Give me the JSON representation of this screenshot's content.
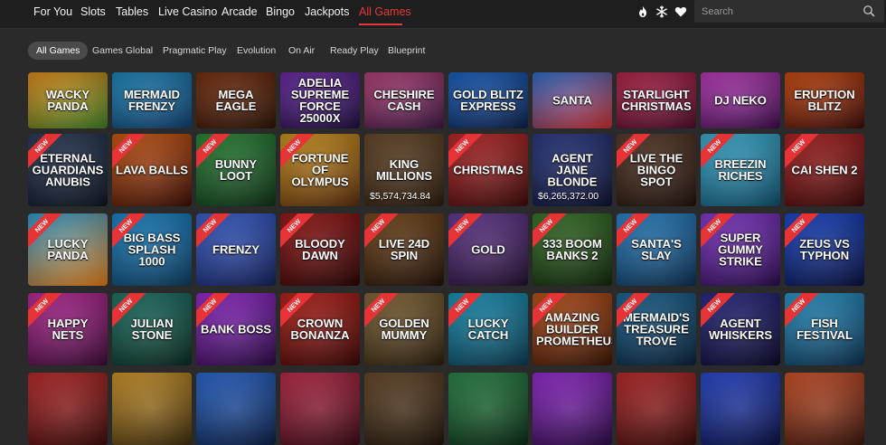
{
  "nav": {
    "items": [
      "For You",
      "Slots",
      "Tables",
      "Live Casino",
      "Arcade",
      "Bingo",
      "Jackpots",
      "All Games"
    ],
    "active_index": 7,
    "icons": [
      "flame-icon",
      "snowflake-icon",
      "heart-icon"
    ],
    "search_placeholder": "Search"
  },
  "providers": {
    "items": [
      "All Games",
      "Games Global",
      "Pragmatic Play",
      "Evolution",
      "On Air",
      "Ready Play",
      "Blueprint"
    ],
    "active_index": 0
  },
  "colors": {
    "accent": "#e8383a",
    "badge": "#e63336"
  },
  "rows": [
    [
      {
        "title": "Wacky Panda",
        "bg": [
          "#e98e1b",
          "#3c7d22"
        ],
        "badge": "",
        "jackpot": ""
      },
      {
        "title": "Mermaid Frenzy",
        "bg": [
          "#1d8ac0",
          "#0f3c6a"
        ],
        "badge": "",
        "jackpot": ""
      },
      {
        "title": "Mega Eagle",
        "bg": [
          "#7a2f0e",
          "#2b1205"
        ],
        "badge": "",
        "jackpot": ""
      },
      {
        "title": "Adelia Supreme Force 25000x",
        "bg": [
          "#6b2aa8",
          "#1f0d3e"
        ],
        "badge": "",
        "jackpot": ""
      },
      {
        "title": "Cheshire Cash",
        "bg": [
          "#b8417a",
          "#3b1640"
        ],
        "badge": "",
        "jackpot": ""
      },
      {
        "title": "Gold Blitz Express",
        "bg": [
          "#1a63c7",
          "#0a1f48"
        ],
        "badge": "",
        "jackpot": ""
      },
      {
        "title": "Santa",
        "bg": [
          "#2d6fd1",
          "#c82c2c"
        ],
        "badge": "",
        "jackpot": ""
      },
      {
        "title": "Starlight Christmas",
        "bg": [
          "#b8254a",
          "#4c0a2a"
        ],
        "badge": "",
        "jackpot": ""
      },
      {
        "title": "DJ Neko",
        "bg": [
          "#c03bbf",
          "#3c0c4a"
        ],
        "badge": "",
        "jackpot": ""
      },
      {
        "title": "Eruption Blitz",
        "bg": [
          "#d14a10",
          "#3a0a05"
        ],
        "badge": "",
        "jackpot": ""
      }
    ],
    [
      {
        "title": "Eternal Guardians Anubis",
        "bg": [
          "#2a3c5a",
          "#0d1422"
        ],
        "badge": "NEW",
        "jackpot": ""
      },
      {
        "title": "Lava Balls",
        "bg": [
          "#d65b14",
          "#3b0d04"
        ],
        "badge": "NEW",
        "jackpot": ""
      },
      {
        "title": "Bunny Loot",
        "bg": [
          "#2c8b3a",
          "#0d3016"
        ],
        "badge": "NEW",
        "jackpot": ""
      },
      {
        "title": "Fortune of Olympus",
        "bg": [
          "#d59a1f",
          "#5a2b0a"
        ],
        "badge": "NEW",
        "jackpot": ""
      },
      {
        "title": "King Millions",
        "bg": [
          "#6a4a2a",
          "#2a1a0c"
        ],
        "badge": "",
        "jackpot": "$5,574,734.84"
      },
      {
        "title": "Christmas",
        "bg": [
          "#c22a2a",
          "#3e0909"
        ],
        "badge": "NEW",
        "jackpot": ""
      },
      {
        "title": "Agent Jane Blonde",
        "bg": [
          "#2c3a8a",
          "#0c112e"
        ],
        "badge": "",
        "jackpot": "$6,265,372.00"
      },
      {
        "title": "Live The Bingo Spot",
        "bg": [
          "#5b3a2a",
          "#1f120b"
        ],
        "badge": "NEW",
        "jackpot": ""
      },
      {
        "title": "Breezin Riches",
        "bg": [
          "#3fb4d8",
          "#0e4e6b"
        ],
        "badge": "NEW",
        "jackpot": ""
      },
      {
        "title": "Cai Shen 2",
        "bg": [
          "#b52222",
          "#3a0808"
        ],
        "badge": "NEW",
        "jackpot": ""
      }
    ],
    [
      {
        "title": "Lucky Panda",
        "bg": [
          "#2fa0d6",
          "#e07a14"
        ],
        "badge": "NEW",
        "jackpot": ""
      },
      {
        "title": "Big Bass Splash 1000",
        "bg": [
          "#1b8bd0",
          "#0b3a5e"
        ],
        "badge": "NEW",
        "jackpot": ""
      },
      {
        "title": "Frenzy",
        "bg": [
          "#3a63d6",
          "#14205c"
        ],
        "badge": "NEW",
        "jackpot": ""
      },
      {
        "title": "Bloody Dawn",
        "bg": [
          "#a11818",
          "#2a0303"
        ],
        "badge": "NEW",
        "jackpot": ""
      },
      {
        "title": "Live 24D Spin",
        "bg": [
          "#7a4a1a",
          "#201008"
        ],
        "badge": "NEW",
        "jackpot": ""
      },
      {
        "title": "Gold",
        "bg": [
          "#6a3a9a",
          "#20102e"
        ],
        "badge": "NEW",
        "jackpot": ""
      },
      {
        "title": "333 Boom Banks 2",
        "bg": [
          "#3a7a2a",
          "#10240a"
        ],
        "badge": "NEW",
        "jackpot": ""
      },
      {
        "title": "Santa's Slay",
        "bg": [
          "#2a8ad0",
          "#0c2e50"
        ],
        "badge": "NEW",
        "jackpot": ""
      },
      {
        "title": "Super Gummy Strike",
        "bg": [
          "#8a3ad6",
          "#2a0a4e"
        ],
        "badge": "NEW",
        "jackpot": ""
      },
      {
        "title": "Zeus vs Typhon",
        "bg": [
          "#1a4ad6",
          "#08103e"
        ],
        "badge": "NEW",
        "jackpot": ""
      }
    ],
    [
      {
        "title": "Happy Nets",
        "bg": [
          "#c22aa0",
          "#3c0a34"
        ],
        "badge": "NEW",
        "jackpot": ""
      },
      {
        "title": "Julian Stone",
        "bg": [
          "#1e7a6a",
          "#0a2a22"
        ],
        "badge": "NEW",
        "jackpot": ""
      },
      {
        "title": "Bank Boss",
        "bg": [
          "#9a2ad6",
          "#2a0a44"
        ],
        "badge": "NEW",
        "jackpot": ""
      },
      {
        "title": "Crown Bonanza",
        "bg": [
          "#c0221a",
          "#3a0604"
        ],
        "badge": "NEW",
        "jackpot": ""
      },
      {
        "title": "Golden Mummy",
        "bg": [
          "#8a6a3a",
          "#2a1e0c"
        ],
        "badge": "NEW",
        "jackpot": ""
      },
      {
        "title": "Lucky Catch",
        "bg": [
          "#1a9ac0",
          "#0a3a4e"
        ],
        "badge": "NEW",
        "jackpot": ""
      },
      {
        "title": "Amazing Builder Prometheus",
        "bg": [
          "#c2541a",
          "#3a1404"
        ],
        "badge": "NEW",
        "jackpot": ""
      },
      {
        "title": "Mermaid's Treasure Trove",
        "bg": [
          "#1a6a9a",
          "#0a2036"
        ],
        "badge": "NEW",
        "jackpot": ""
      },
      {
        "title": "Agent Whiskers",
        "bg": [
          "#2a2a8a",
          "#0a0a2a"
        ],
        "badge": "NEW",
        "jackpot": ""
      },
      {
        "title": "Fish Festival",
        "bg": [
          "#2a9ad0",
          "#0a304e"
        ],
        "badge": "NEW",
        "jackpot": ""
      }
    ],
    [
      {
        "title": "",
        "bg": [
          "#c22a2a",
          "#3a0a0a"
        ],
        "badge": "",
        "jackpot": ""
      },
      {
        "title": "",
        "bg": [
          "#d69a2a",
          "#3a2a0a"
        ],
        "badge": "",
        "jackpot": ""
      },
      {
        "title": "",
        "bg": [
          "#2a6ad6",
          "#0a1e44"
        ],
        "badge": "",
        "jackpot": ""
      },
      {
        "title": "",
        "bg": [
          "#c22a4a",
          "#3a0a14"
        ],
        "badge": "",
        "jackpot": ""
      },
      {
        "title": "",
        "bg": [
          "#6a4a2a",
          "#1e140a"
        ],
        "badge": "",
        "jackpot": ""
      },
      {
        "title": "",
        "bg": [
          "#2a8a4a",
          "#0a2a14"
        ],
        "badge": "",
        "jackpot": ""
      },
      {
        "title": "",
        "bg": [
          "#9a2ad6",
          "#2a0a44"
        ],
        "badge": "",
        "jackpot": ""
      },
      {
        "title": "",
        "bg": [
          "#c22a2a",
          "#3a0a0a"
        ],
        "badge": "",
        "jackpot": ""
      },
      {
        "title": "",
        "bg": [
          "#2a4ad6",
          "#0a1044"
        ],
        "badge": "",
        "jackpot": ""
      },
      {
        "title": "",
        "bg": [
          "#d6542a",
          "#3a140a"
        ],
        "badge": "",
        "jackpot": ""
      }
    ]
  ]
}
